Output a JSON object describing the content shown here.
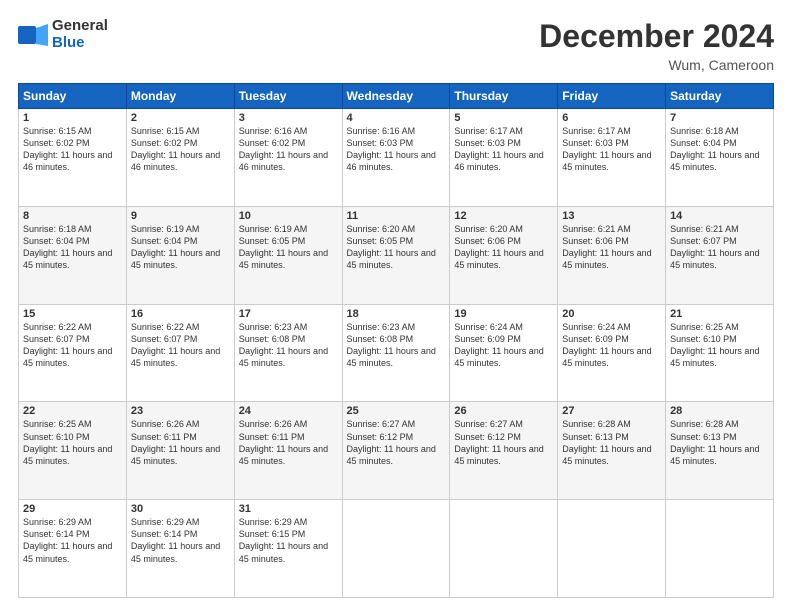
{
  "header": {
    "logo_line1": "General",
    "logo_line2": "Blue",
    "month": "December 2024",
    "location": "Wum, Cameroon"
  },
  "weekdays": [
    "Sunday",
    "Monday",
    "Tuesday",
    "Wednesday",
    "Thursday",
    "Friday",
    "Saturday"
  ],
  "weeks": [
    [
      {
        "day": "1",
        "sunrise": "6:15 AM",
        "sunset": "6:02 PM",
        "daylight": "11 hours and 46 minutes."
      },
      {
        "day": "2",
        "sunrise": "6:15 AM",
        "sunset": "6:02 PM",
        "daylight": "11 hours and 46 minutes."
      },
      {
        "day": "3",
        "sunrise": "6:16 AM",
        "sunset": "6:02 PM",
        "daylight": "11 hours and 46 minutes."
      },
      {
        "day": "4",
        "sunrise": "6:16 AM",
        "sunset": "6:03 PM",
        "daylight": "11 hours and 46 minutes."
      },
      {
        "day": "5",
        "sunrise": "6:17 AM",
        "sunset": "6:03 PM",
        "daylight": "11 hours and 46 minutes."
      },
      {
        "day": "6",
        "sunrise": "6:17 AM",
        "sunset": "6:03 PM",
        "daylight": "11 hours and 45 minutes."
      },
      {
        "day": "7",
        "sunrise": "6:18 AM",
        "sunset": "6:04 PM",
        "daylight": "11 hours and 45 minutes."
      }
    ],
    [
      {
        "day": "8",
        "sunrise": "6:18 AM",
        "sunset": "6:04 PM",
        "daylight": "11 hours and 45 minutes."
      },
      {
        "day": "9",
        "sunrise": "6:19 AM",
        "sunset": "6:04 PM",
        "daylight": "11 hours and 45 minutes."
      },
      {
        "day": "10",
        "sunrise": "6:19 AM",
        "sunset": "6:05 PM",
        "daylight": "11 hours and 45 minutes."
      },
      {
        "day": "11",
        "sunrise": "6:20 AM",
        "sunset": "6:05 PM",
        "daylight": "11 hours and 45 minutes."
      },
      {
        "day": "12",
        "sunrise": "6:20 AM",
        "sunset": "6:06 PM",
        "daylight": "11 hours and 45 minutes."
      },
      {
        "day": "13",
        "sunrise": "6:21 AM",
        "sunset": "6:06 PM",
        "daylight": "11 hours and 45 minutes."
      },
      {
        "day": "14",
        "sunrise": "6:21 AM",
        "sunset": "6:07 PM",
        "daylight": "11 hours and 45 minutes."
      }
    ],
    [
      {
        "day": "15",
        "sunrise": "6:22 AM",
        "sunset": "6:07 PM",
        "daylight": "11 hours and 45 minutes."
      },
      {
        "day": "16",
        "sunrise": "6:22 AM",
        "sunset": "6:07 PM",
        "daylight": "11 hours and 45 minutes."
      },
      {
        "day": "17",
        "sunrise": "6:23 AM",
        "sunset": "6:08 PM",
        "daylight": "11 hours and 45 minutes."
      },
      {
        "day": "18",
        "sunrise": "6:23 AM",
        "sunset": "6:08 PM",
        "daylight": "11 hours and 45 minutes."
      },
      {
        "day": "19",
        "sunrise": "6:24 AM",
        "sunset": "6:09 PM",
        "daylight": "11 hours and 45 minutes."
      },
      {
        "day": "20",
        "sunrise": "6:24 AM",
        "sunset": "6:09 PM",
        "daylight": "11 hours and 45 minutes."
      },
      {
        "day": "21",
        "sunrise": "6:25 AM",
        "sunset": "6:10 PM",
        "daylight": "11 hours and 45 minutes."
      }
    ],
    [
      {
        "day": "22",
        "sunrise": "6:25 AM",
        "sunset": "6:10 PM",
        "daylight": "11 hours and 45 minutes."
      },
      {
        "day": "23",
        "sunrise": "6:26 AM",
        "sunset": "6:11 PM",
        "daylight": "11 hours and 45 minutes."
      },
      {
        "day": "24",
        "sunrise": "6:26 AM",
        "sunset": "6:11 PM",
        "daylight": "11 hours and 45 minutes."
      },
      {
        "day": "25",
        "sunrise": "6:27 AM",
        "sunset": "6:12 PM",
        "daylight": "11 hours and 45 minutes."
      },
      {
        "day": "26",
        "sunrise": "6:27 AM",
        "sunset": "6:12 PM",
        "daylight": "11 hours and 45 minutes."
      },
      {
        "day": "27",
        "sunrise": "6:28 AM",
        "sunset": "6:13 PM",
        "daylight": "11 hours and 45 minutes."
      },
      {
        "day": "28",
        "sunrise": "6:28 AM",
        "sunset": "6:13 PM",
        "daylight": "11 hours and 45 minutes."
      }
    ],
    [
      {
        "day": "29",
        "sunrise": "6:29 AM",
        "sunset": "6:14 PM",
        "daylight": "11 hours and 45 minutes."
      },
      {
        "day": "30",
        "sunrise": "6:29 AM",
        "sunset": "6:14 PM",
        "daylight": "11 hours and 45 minutes."
      },
      {
        "day": "31",
        "sunrise": "6:29 AM",
        "sunset": "6:15 PM",
        "daylight": "11 hours and 45 minutes."
      },
      null,
      null,
      null,
      null
    ]
  ]
}
